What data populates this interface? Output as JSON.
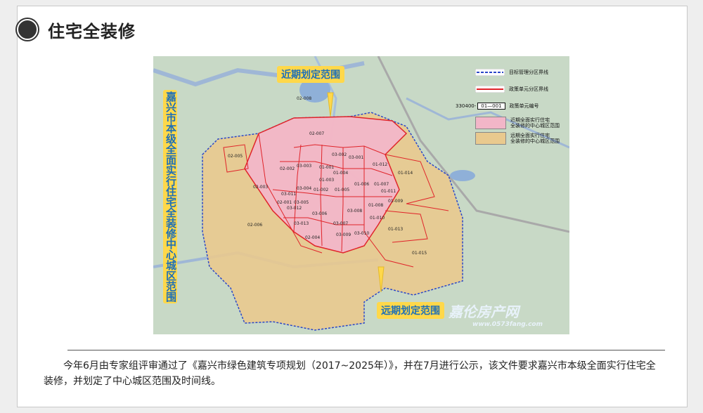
{
  "header": {
    "title": "住宅全装修"
  },
  "map": {
    "vertical_label": "嘉兴市本级全面实行住宅全装修中心城区范围",
    "near_term_tag": "近期划定范围",
    "long_term_tag": "远期划定范围",
    "near_term_color": "#f2b6c8",
    "long_term_color": "#e9c98e",
    "boundary_color": "#e0242a",
    "mgmt_boundary_color": "#2a46c8",
    "legend": {
      "mgmt_boundary": "目标管理分区界线",
      "policy_boundary": "政策单元分区界线",
      "unit_code_example": "330400-",
      "unit_code_box": "01—001",
      "unit_code_label": "政策单元编号",
      "near_term_line1": "近期全面实行住宅",
      "near_term_line2": "全装修的中心城区范围",
      "long_term_line1": "远期全面实行住宅",
      "long_term_line2": "全装修的中心城区范围"
    },
    "units": [
      "02-008",
      "02-007",
      "02-005",
      "02-002",
      "02-003",
      "02-001",
      "02-006",
      "02-004",
      "03-002",
      "03-003",
      "03-001",
      "03-004",
      "03-005",
      "03-006",
      "03-007",
      "03-008",
      "03-009",
      "03-010",
      "03-011",
      "03-012",
      "03-013",
      "01-001",
      "01-002",
      "01-003",
      "01-004",
      "01-005",
      "01-006",
      "01-007",
      "01-008",
      "01-009",
      "01-010",
      "01-011",
      "01-012",
      "01-013",
      "01-014",
      "01-015"
    ],
    "watermark": "嘉伦房产网",
    "watermark_url": "www.0573fang.com"
  },
  "caption": "今年6月由专家组评审通过了《嘉兴市绿色建筑专项规划（2017~2025年）》，并在7月进行公示，该文件要求嘉兴市本级全面实行住宅全装修，并划定了中心城区范围及时间线。"
}
